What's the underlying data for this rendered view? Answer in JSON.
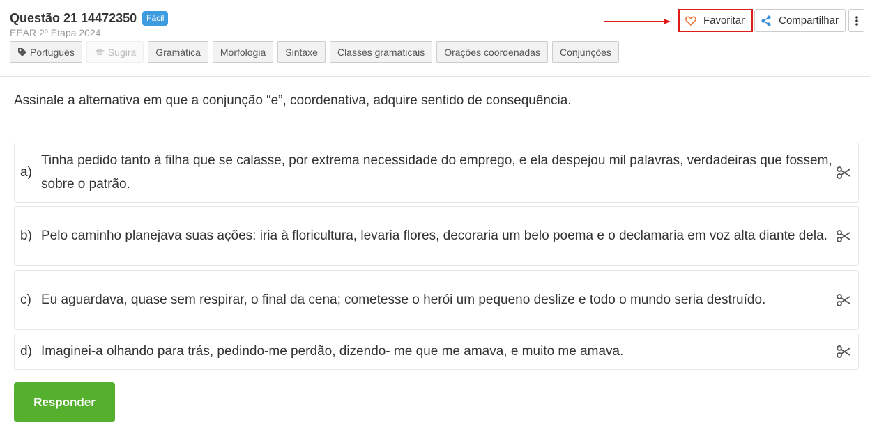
{
  "question": {
    "title": "Questão 21 14472350",
    "difficulty": "Fácil",
    "exam": "EEAR 2º Etapa 2024"
  },
  "tags": [
    {
      "label": "Português",
      "icon": "tag-icon"
    },
    {
      "label": "Sugira",
      "icon": "graduation-cap-icon",
      "disabled": true
    },
    {
      "label": "Gramática"
    },
    {
      "label": "Morfologia"
    },
    {
      "label": "Sintaxe"
    },
    {
      "label": "Classes gramaticais"
    },
    {
      "label": "Orações coordenadas"
    },
    {
      "label": "Conjunções"
    }
  ],
  "actions": {
    "favorite_label": "Favoritar",
    "share_label": "Compartilhar"
  },
  "statement": "Assinale a alternativa em que a conjunção “e”, coordenativa, adquire sentido de consequência.",
  "alternatives": [
    {
      "letter": "a)",
      "text": "Tinha pedido tanto à filha que se calasse, por extrema necessidade do emprego, e ela despejou mil palavras, verdadeiras que fossem, sobre o patrão."
    },
    {
      "letter": "b)",
      "text": "Pelo caminho planejava suas ações: iria à floricultura, levaria flores, decoraria um belo poema e o declamaria em voz alta diante dela."
    },
    {
      "letter": "c)",
      "text": "Eu aguardava, quase sem respirar, o final da cena; cometesse o herói um pequeno deslize e todo o mundo seria destruído."
    },
    {
      "letter": "d)",
      "text": "Imaginei-a olhando para trás, pedindo-me perdão, dizendo- me que me amava, e muito me amava."
    }
  ],
  "submit_label": "Responder",
  "colors": {
    "badge": "#3d9be0",
    "highlight": "#e01b1b",
    "submit": "#55b02e",
    "heart": "#e8773a",
    "share": "#3d8fd6"
  }
}
